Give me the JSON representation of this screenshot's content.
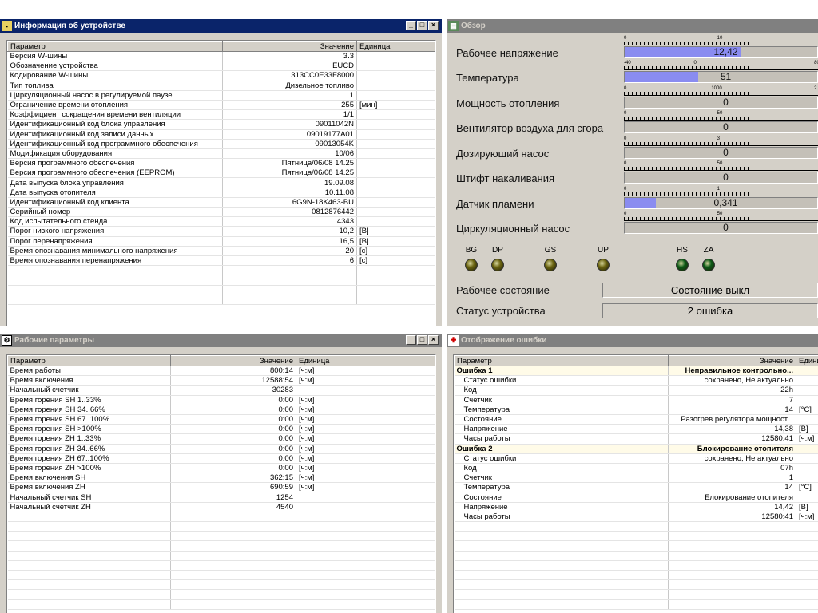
{
  "device_info": {
    "title": "Информация об устройстве",
    "columns": [
      "Параметр",
      "Значение",
      "Единица"
    ],
    "rows": [
      [
        "Версия W-шины",
        "3.3",
        ""
      ],
      [
        "Обозначение устройства",
        "EUCD",
        ""
      ],
      [
        "Кодирование W-шины",
        "313CC0E33F8000",
        ""
      ],
      [
        "Тип топлива",
        "Дизельное топливо",
        ""
      ],
      [
        "Циркуляционный насос в регулируемой паузе",
        "1",
        ""
      ],
      [
        "Ограничение времени отопления",
        "255",
        "[мин]"
      ],
      [
        "Коэффициент сокращения времени вентиляции",
        "1/1",
        ""
      ],
      [
        "Идентификационный код блока управления",
        "09011042N",
        ""
      ],
      [
        "Идентификационный код записи данных",
        "09019177A01",
        ""
      ],
      [
        "Идентификационный код программного обеспечения",
        "09013054K",
        ""
      ],
      [
        "Модификация оборудования",
        "10/06",
        ""
      ],
      [
        "Версия программного обеспечения",
        "Пятница/06/08 14.25",
        ""
      ],
      [
        "Версия программного обеспечения (EEPROM)",
        "Пятница/06/08 14.25",
        ""
      ],
      [
        "Дата выпуска блока управления",
        "19.09.08",
        ""
      ],
      [
        "Дата выпуска отопителя",
        "10.11.08",
        ""
      ],
      [
        "Идентификационный код клиента",
        "6G9N-18K463-BU",
        ""
      ],
      [
        "Серийный номер",
        "0812876442",
        ""
      ],
      [
        "Код испытательного стенда",
        "4343",
        ""
      ],
      [
        "Порог низкого напряжения",
        "10,2",
        "[В]"
      ],
      [
        "Порог перенапряжения",
        "16,5",
        "[В]"
      ],
      [
        "Время опознавания минимального напряжения",
        "20",
        "[с]"
      ],
      [
        "Время опознавания перенапряжения",
        "6",
        "[с]"
      ]
    ]
  },
  "overview": {
    "title": "Обзор",
    "gauges": [
      {
        "label": "Рабочее напряжение",
        "value": "12,42",
        "fill": 0.6,
        "scale": [
          "0",
          "10"
        ],
        "scale_pos": [
          0,
          0.48
        ]
      },
      {
        "label": "Температура",
        "value": "51",
        "fill": 0.38,
        "scale": [
          "-40",
          "0",
          "80"
        ],
        "scale_pos": [
          0,
          0.36,
          0.98
        ]
      },
      {
        "label": "Мощность отопления",
        "value": "0",
        "fill": 0,
        "scale": [
          "0",
          "1000",
          "2"
        ],
        "scale_pos": [
          0,
          0.45,
          0.98
        ]
      },
      {
        "label": "Вентилятор воздуха для сгора",
        "value": "0",
        "fill": 0,
        "scale": [
          "0",
          "50"
        ],
        "scale_pos": [
          0,
          0.48
        ]
      },
      {
        "label": "Дозирующий насос",
        "value": "0",
        "fill": 0,
        "scale": [
          "0",
          "3"
        ],
        "scale_pos": [
          0,
          0.48
        ]
      },
      {
        "label": "Штифт накаливания",
        "value": "0",
        "fill": 0,
        "scale": [
          "0",
          "50"
        ],
        "scale_pos": [
          0,
          0.48
        ]
      },
      {
        "label": "Датчик пламени",
        "value": "0,341",
        "fill": 0.16,
        "scale": [
          "0",
          "1"
        ],
        "scale_pos": [
          0,
          0.48
        ]
      },
      {
        "label": "Циркуляционный насос",
        "value": "0",
        "fill": 0,
        "scale": [
          "0",
          "50"
        ],
        "scale_pos": [
          0,
          0.48
        ]
      }
    ],
    "leds": [
      {
        "label": "BG",
        "color": "#6b6410"
      },
      {
        "label": "DP",
        "color": "#6b6410"
      },
      {
        "label": "GS",
        "color": "#6b6410"
      },
      {
        "label": "UP",
        "color": "#6b6410"
      },
      {
        "label": "HS",
        "color": "#0b5a16"
      },
      {
        "label": "ZA",
        "color": "#0b5a16"
      }
    ],
    "operating_state_label": "Рабочее состояние",
    "operating_state_value": "Состояние выкл",
    "device_status_label": "Статус устройства",
    "device_status_value": "2 ошибка"
  },
  "work_params": {
    "title": "Рабочие параметры",
    "columns": [
      "Параметр",
      "Значение",
      "Единица"
    ],
    "rows": [
      [
        "Время работы",
        "800:14",
        "[ч:м]"
      ],
      [
        "Время включения",
        "12588:54",
        "[ч:м]"
      ],
      [
        "Начальный счетчик",
        "30283",
        ""
      ],
      [
        "Время горения SH 1..33%",
        "0:00",
        "[ч:м]"
      ],
      [
        "Время горения SH 34..66%",
        "0:00",
        "[ч:м]"
      ],
      [
        "Время горения SH 67..100%",
        "0:00",
        "[ч:м]"
      ],
      [
        "Время горения SH >100%",
        "0:00",
        "[ч:м]"
      ],
      [
        "Время горения ZH 1..33%",
        "0:00",
        "[ч:м]"
      ],
      [
        "Время горения ZH 34..66%",
        "0:00",
        "[ч:м]"
      ],
      [
        "Время горения ZH 67..100%",
        "0:00",
        "[ч:м]"
      ],
      [
        "Время горения ZH >100%",
        "0:00",
        "[ч:м]"
      ],
      [
        "Время включения SH",
        "362:15",
        "[ч:м]"
      ],
      [
        "Время включения ZH",
        "690:59",
        "[ч:м]"
      ],
      [
        "Начальный счетчик SH",
        "1254",
        ""
      ],
      [
        "Начальный счетчик ZH",
        "4540",
        ""
      ]
    ]
  },
  "errors": {
    "title": "Отображение ошибки",
    "columns": [
      "Параметр",
      "Значение",
      "Едини"
    ],
    "rows": [
      {
        "group": true,
        "p": "Ошибка 1",
        "v": "Неправильное контрольно...",
        "u": ""
      },
      {
        "p": "Статус ошибки",
        "v": "сохранено, Не актуально",
        "u": ""
      },
      {
        "p": "Код",
        "v": "22h",
        "u": ""
      },
      {
        "p": "Счетчик",
        "v": "7",
        "u": ""
      },
      {
        "p": "Температура",
        "v": "14",
        "u": "[°C]"
      },
      {
        "p": "Состояние",
        "v": "Разогрев регулятора мощност...",
        "u": ""
      },
      {
        "p": "Напряжение",
        "v": "14,38",
        "u": "[В]"
      },
      {
        "p": "Часы работы",
        "v": "12580:41",
        "u": "[ч:м]"
      },
      {
        "group": true,
        "p": "Ошибка 2",
        "v": "Блокирование отопителя",
        "u": ""
      },
      {
        "p": "Статус ошибки",
        "v": "сохранено, Не актуально",
        "u": ""
      },
      {
        "p": "Код",
        "v": "07h",
        "u": ""
      },
      {
        "p": "Счетчик",
        "v": "1",
        "u": ""
      },
      {
        "p": "Температура",
        "v": "14",
        "u": "[°C]"
      },
      {
        "p": "Состояние",
        "v": "Блокирование отопителя",
        "u": ""
      },
      {
        "p": "Напряжение",
        "v": "14,42",
        "u": "[В]"
      },
      {
        "p": "Часы работы",
        "v": "12580:41",
        "u": "[ч:м]"
      }
    ]
  },
  "window_buttons": {
    "min": "_",
    "max": "□",
    "close": "×"
  }
}
